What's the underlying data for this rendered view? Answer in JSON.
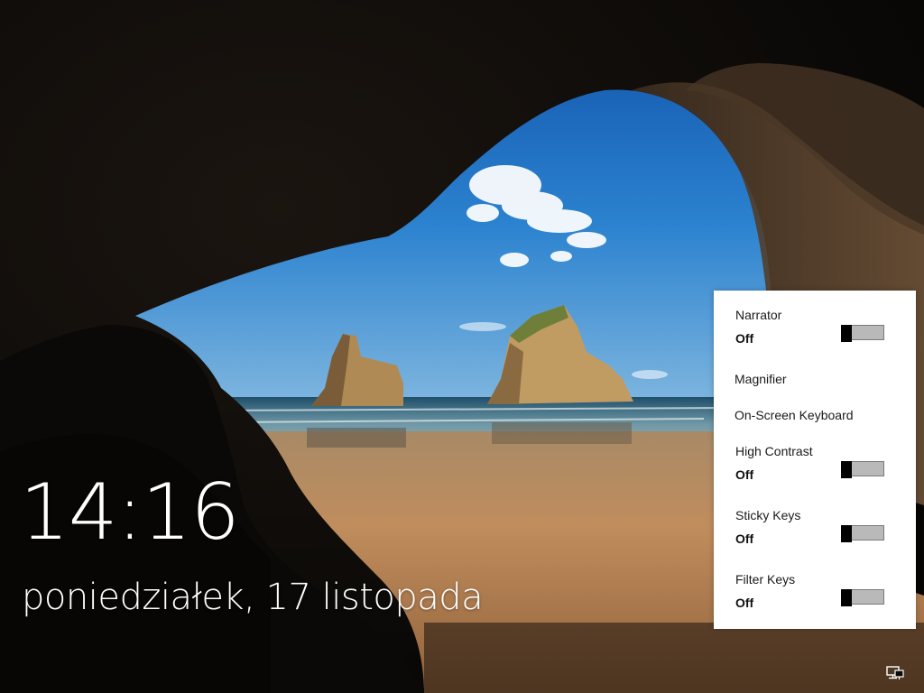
{
  "lockscreen": {
    "time": "14:16",
    "date": "poniedziałek, 17 listopada"
  },
  "ease_of_access": {
    "narrator": {
      "label": "Narrator",
      "status": "Off",
      "on": false
    },
    "magnifier": {
      "label": "Magnifier"
    },
    "onscreen_keyboard": {
      "label": "On-Screen Keyboard"
    },
    "high_contrast": {
      "label": "High Contrast",
      "status": "Off",
      "on": false
    },
    "sticky_keys": {
      "label": "Sticky Keys",
      "status": "Off",
      "on": false
    },
    "filter_keys": {
      "label": "Filter Keys",
      "status": "Off",
      "on": false
    }
  },
  "tray": {
    "network_icon": "network-icon"
  },
  "colors": {
    "sky": "#1f6fc2",
    "sand": "#b7895a",
    "panel": "#ffffff",
    "toggle_off_track": "#b9b9b9",
    "toggle_thumb": "#000000"
  }
}
